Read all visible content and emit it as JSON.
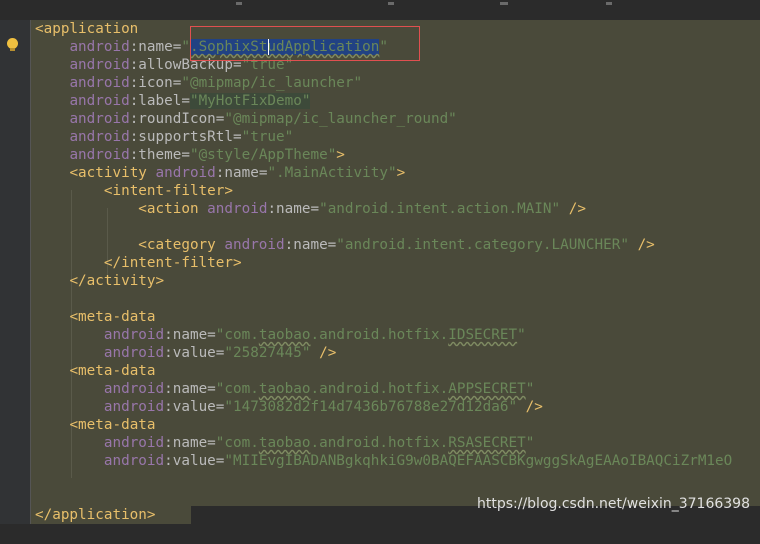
{
  "code": {
    "l1_tag": "<application",
    "l2_ns": "android",
    "l2_attr": ":name=",
    "l2_q1": "\"",
    "l2_sel": ".SophixStudApplication",
    "l2_q2": "\"",
    "l3_ns": "android",
    "l3_attr": ":allowBackup=",
    "l3_val": "\"true\"",
    "l4_ns": "android",
    "l4_attr": ":icon=",
    "l4_val": "\"@mipmap/ic_launcher\"",
    "l5_ns": "android",
    "l5_attr": ":label=",
    "l5_val": "\"MyHotFixDemo\"",
    "l6_ns": "android",
    "l6_attr": ":roundIcon=",
    "l6_val": "\"@mipmap/ic_launcher_round\"",
    "l7_ns": "android",
    "l7_attr": ":supportsRtl=",
    "l7_val": "\"true\"",
    "l8_ns": "android",
    "l8_attr": ":theme=",
    "l8_val": "\"@style/AppTheme\"",
    "l8_end": ">",
    "l9_tag": "<activity",
    "l9_ns": "android",
    "l9_attr": ":name=",
    "l9_val": "\".MainActivity\"",
    "l9_end": ">",
    "l10_tag": "<intent-filter>",
    "l11_tag": "<action",
    "l11_ns": "android",
    "l11_attr": ":name=",
    "l11_val": "\"android.intent.action.MAIN\"",
    "l11_end": "/>",
    "l13_tag": "<category",
    "l13_ns": "android",
    "l13_attr": ":name=",
    "l13_val": "\"android.intent.category.LAUNCHER\"",
    "l13_end": "/>",
    "l14_tag": "</intent-filter>",
    "l15_tag": "</activity>",
    "l17_tag": "<meta-data",
    "l18_ns": "android",
    "l18_attr": ":name=",
    "l18_v1": "\"com.",
    "l18_v2": "taobao",
    "l18_v3": ".android.hotfix.",
    "l18_v4": "IDSECRET",
    "l18_v5": "\"",
    "l19_ns": "android",
    "l19_attr": ":value=",
    "l19_val": "\"25827445\"",
    "l19_end": "/>",
    "l20_tag": "<meta-data",
    "l21_ns": "android",
    "l21_attr": ":name=",
    "l21_v1": "\"com.",
    "l21_v2": "taobao",
    "l21_v3": ".android.hotfix.",
    "l21_v4": "APPSECRET",
    "l21_v5": "\"",
    "l22_ns": "android",
    "l22_attr": ":value=",
    "l22_val": "\"1473082d2f14d7436b76788e27d12da6\"",
    "l22_end": "/>",
    "l23_tag": "<meta-data",
    "l24_ns": "android",
    "l24_attr": ":name=",
    "l24_v1": "\"com.",
    "l24_v2": "taobao",
    "l24_v3": ".android.hotfix.",
    "l24_v4": "RSASECRET",
    "l24_v5": "\"",
    "l25_ns": "android",
    "l25_attr": ":value=",
    "l25_val": "\"MIIEvgIBADANBgkqhkiG9w0BAQEFAASCBKgwggSkAgEAAoIBAQCiZrM1eO",
    "l28_tag": "</application>"
  },
  "watermark": "https://blog.csdn.net/weixin_37166398",
  "icons": {
    "intention": "lightbulb-icon"
  },
  "colors": {
    "tag": "#e8bf6a",
    "namespace": "#9876aa",
    "value": "#6a8759",
    "highlight_box": "#e05050"
  }
}
